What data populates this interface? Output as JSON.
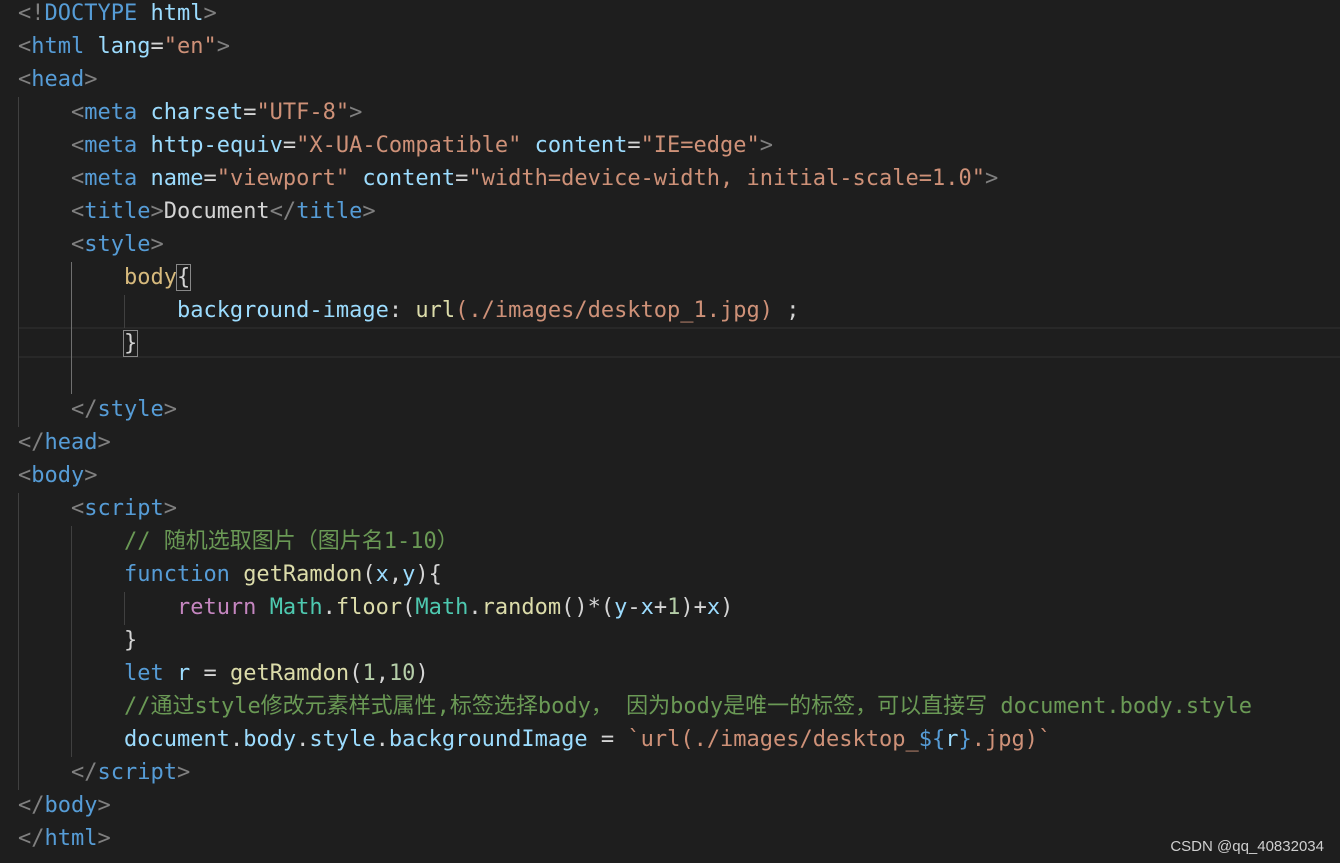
{
  "editor": {
    "watermark": "CSDN @qq_40832034",
    "lines": [
      [
        [
          "<!",
          "punc"
        ],
        [
          "DOCTYPE",
          "tag"
        ],
        [
          " ",
          "text"
        ],
        [
          "html",
          "attr"
        ],
        [
          ">",
          "punc"
        ]
      ],
      [
        [
          "<",
          "punc"
        ],
        [
          "html",
          "tag"
        ],
        [
          " ",
          "text"
        ],
        [
          "lang",
          "attr"
        ],
        [
          "=",
          "text"
        ],
        [
          "\"en\"",
          "str"
        ],
        [
          ">",
          "punc"
        ]
      ],
      [
        [
          "<",
          "punc"
        ],
        [
          "head",
          "tag"
        ],
        [
          ">",
          "punc"
        ]
      ],
      [
        [
          "    ",
          "text"
        ],
        [
          "<",
          "punc"
        ],
        [
          "meta",
          "tag"
        ],
        [
          " ",
          "text"
        ],
        [
          "charset",
          "attr"
        ],
        [
          "=",
          "text"
        ],
        [
          "\"UTF-8\"",
          "str"
        ],
        [
          ">",
          "punc"
        ]
      ],
      [
        [
          "    ",
          "text"
        ],
        [
          "<",
          "punc"
        ],
        [
          "meta",
          "tag"
        ],
        [
          " ",
          "text"
        ],
        [
          "http-equiv",
          "attr"
        ],
        [
          "=",
          "text"
        ],
        [
          "\"X-UA-Compatible\"",
          "str"
        ],
        [
          " ",
          "text"
        ],
        [
          "content",
          "attr"
        ],
        [
          "=",
          "text"
        ],
        [
          "\"IE=edge\"",
          "str"
        ],
        [
          ">",
          "punc"
        ]
      ],
      [
        [
          "    ",
          "text"
        ],
        [
          "<",
          "punc"
        ],
        [
          "meta",
          "tag"
        ],
        [
          " ",
          "text"
        ],
        [
          "name",
          "attr"
        ],
        [
          "=",
          "text"
        ],
        [
          "\"viewport\"",
          "str"
        ],
        [
          " ",
          "text"
        ],
        [
          "content",
          "attr"
        ],
        [
          "=",
          "text"
        ],
        [
          "\"width=device-width, initial-scale=1.0\"",
          "str"
        ],
        [
          ">",
          "punc"
        ]
      ],
      [
        [
          "    ",
          "text"
        ],
        [
          "<",
          "punc"
        ],
        [
          "title",
          "tag"
        ],
        [
          ">",
          "punc"
        ],
        [
          "Document",
          "text"
        ],
        [
          "</",
          "punc"
        ],
        [
          "title",
          "tag"
        ],
        [
          ">",
          "punc"
        ]
      ],
      [
        [
          "    ",
          "text"
        ],
        [
          "<",
          "punc"
        ],
        [
          "style",
          "tag"
        ],
        [
          ">",
          "punc"
        ]
      ],
      [
        [
          "        ",
          "text"
        ],
        [
          "body",
          "sel"
        ],
        [
          "{",
          "brace"
        ]
      ],
      [
        [
          "            ",
          "text"
        ],
        [
          "background-image",
          "prop"
        ],
        [
          ": ",
          "text"
        ],
        [
          "url",
          "func"
        ],
        [
          "(./images/desktop_1.jpg)",
          "str"
        ],
        [
          " ;",
          "text"
        ]
      ],
      [
        [
          "        ",
          "text"
        ],
        [
          "}",
          "brace"
        ]
      ],
      [
        [
          "",
          "text"
        ]
      ],
      [
        [
          "    ",
          "text"
        ],
        [
          "</",
          "punc"
        ],
        [
          "style",
          "tag"
        ],
        [
          ">",
          "punc"
        ]
      ],
      [
        [
          "</",
          "punc"
        ],
        [
          "head",
          "tag"
        ],
        [
          ">",
          "punc"
        ]
      ],
      [
        [
          "<",
          "punc"
        ],
        [
          "body",
          "tag"
        ],
        [
          ">",
          "punc"
        ]
      ],
      [
        [
          "    ",
          "text"
        ],
        [
          "<",
          "punc"
        ],
        [
          "script",
          "tag"
        ],
        [
          ">",
          "punc"
        ]
      ],
      [
        [
          "        ",
          "text"
        ],
        [
          "// 随机选取图片（图片名1-10）",
          "com"
        ]
      ],
      [
        [
          "        ",
          "text"
        ],
        [
          "function",
          "kw"
        ],
        [
          " ",
          "text"
        ],
        [
          "getRamdon",
          "func"
        ],
        [
          "(",
          "text"
        ],
        [
          "x",
          "var"
        ],
        [
          ",",
          "text"
        ],
        [
          "y",
          "var"
        ],
        [
          "){",
          "text"
        ]
      ],
      [
        [
          "            ",
          "text"
        ],
        [
          "return",
          "ctrl"
        ],
        [
          " ",
          "text"
        ],
        [
          "Math",
          "type"
        ],
        [
          ".",
          "text"
        ],
        [
          "floor",
          "func"
        ],
        [
          "(",
          "text"
        ],
        [
          "Math",
          "type"
        ],
        [
          ".",
          "text"
        ],
        [
          "random",
          "func"
        ],
        [
          "()*(",
          "text"
        ],
        [
          "y",
          "var"
        ],
        [
          "-",
          "text"
        ],
        [
          "x",
          "var"
        ],
        [
          "+",
          "text"
        ],
        [
          "1",
          "num"
        ],
        [
          ")+",
          "text"
        ],
        [
          "x",
          "var"
        ],
        [
          ")",
          "text"
        ]
      ],
      [
        [
          "        ",
          "text"
        ],
        [
          "}",
          "text"
        ]
      ],
      [
        [
          "        ",
          "text"
        ],
        [
          "let",
          "kw"
        ],
        [
          " ",
          "text"
        ],
        [
          "r",
          "var"
        ],
        [
          " = ",
          "text"
        ],
        [
          "getRamdon",
          "func"
        ],
        [
          "(",
          "text"
        ],
        [
          "1",
          "num"
        ],
        [
          ",",
          "text"
        ],
        [
          "10",
          "num"
        ],
        [
          ")",
          "text"
        ]
      ],
      [
        [
          "        ",
          "text"
        ],
        [
          "//通过style修改元素样式属性,标签选择body， 因为body是唯一的标签，可以直接写 document.body.style",
          "com"
        ]
      ],
      [
        [
          "        ",
          "text"
        ],
        [
          "document",
          "var"
        ],
        [
          ".",
          "text"
        ],
        [
          "body",
          "var"
        ],
        [
          ".",
          "text"
        ],
        [
          "style",
          "var"
        ],
        [
          ".",
          "text"
        ],
        [
          "backgroundImage",
          "var"
        ],
        [
          " = ",
          "text"
        ],
        [
          "`url(./images/desktop_",
          "str"
        ],
        [
          "${",
          "tpl"
        ],
        [
          "r",
          "var"
        ],
        [
          "}",
          "tpl"
        ],
        [
          ".jpg)`",
          "str"
        ]
      ],
      [
        [
          "    ",
          "text"
        ],
        [
          "</",
          "punc"
        ],
        [
          "script",
          "tag"
        ],
        [
          ">",
          "punc"
        ]
      ],
      [
        [
          "</",
          "punc"
        ],
        [
          "body",
          "tag"
        ],
        [
          ">",
          "punc"
        ]
      ],
      [
        [
          "</",
          "punc"
        ],
        [
          "html",
          "tag"
        ],
        [
          ">",
          "punc"
        ]
      ]
    ]
  }
}
